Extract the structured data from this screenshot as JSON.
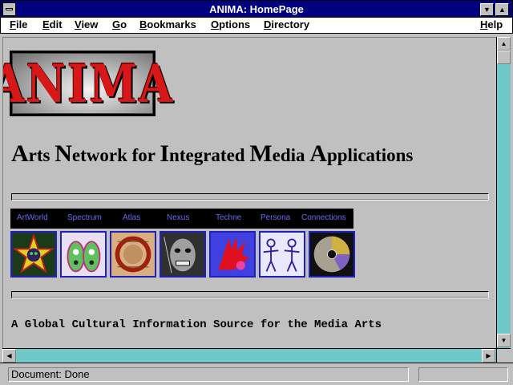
{
  "window": {
    "title": "ANIMA: HomePage"
  },
  "menu": [
    "File",
    "Edit",
    "View",
    "Go",
    "Bookmarks",
    "Options",
    "Directory",
    "Help"
  ],
  "logo": {
    "text": "ANIMA"
  },
  "headline": {
    "words": [
      {
        "cap": "A",
        "rest": "rts "
      },
      {
        "cap": "N",
        "rest": "etwork for "
      },
      {
        "cap": "I",
        "rest": "ntegrated "
      },
      {
        "cap": "M",
        "rest": "edia "
      },
      {
        "cap": "A",
        "rest": "pplications"
      }
    ]
  },
  "nav": {
    "links": [
      "ArtWorld",
      "Spectrum",
      "Atlas",
      "Nexus",
      "Techne",
      "Persona",
      "Connections"
    ],
    "link_color": "#6a6af0"
  },
  "thumbnails": [
    {
      "icon": "star-mask-icon"
    },
    {
      "icon": "footprints-icon"
    },
    {
      "icon": "ring-map-icon"
    },
    {
      "icon": "face-collage-icon"
    },
    {
      "icon": "red-hand-icon"
    },
    {
      "icon": "dancers-icon"
    },
    {
      "icon": "cd-disc-icon"
    }
  ],
  "tagline": "A Global Cultural Information Source for the Media Arts",
  "status": {
    "text": "Document: Done"
  },
  "colors": {
    "titlebar": "#000080",
    "scrollbar_track": "#6fc9c9",
    "thumb_border": "#2020c0",
    "logo_red": "#d81818"
  }
}
